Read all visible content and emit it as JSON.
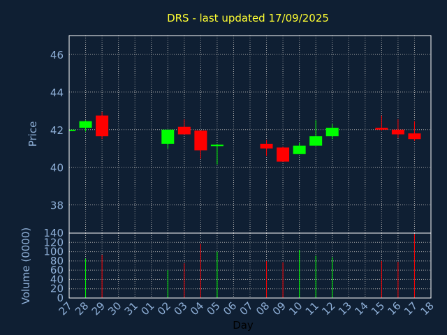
{
  "chart_data": {
    "type": "candlestick",
    "title": "DRS - last updated 17/09/2025",
    "xlabel": "Day",
    "price_ylabel": "Price",
    "volume_ylabel": "Volume (0000)",
    "price_ylim": [
      36.5,
      47
    ],
    "price_yticks": [
      38,
      40,
      42,
      44,
      46
    ],
    "volume_ylim": [
      0,
      140
    ],
    "volume_yticks": [
      0,
      20,
      40,
      60,
      80,
      100,
      120,
      140
    ],
    "grid": true,
    "x_labels": [
      "27",
      "28",
      "29",
      "30",
      "31",
      "01",
      "02",
      "03",
      "04",
      "05",
      "06",
      "07",
      "08",
      "09",
      "10",
      "11",
      "12",
      "13",
      "14",
      "15",
      "16",
      "17",
      "18"
    ],
    "candles": [
      {
        "day": "27",
        "open": 42.0,
        "high": 42.05,
        "low": 41.95,
        "close": 42.0,
        "volume": 0
      },
      {
        "day": "28",
        "open": 42.1,
        "high": 42.5,
        "low": 41.9,
        "close": 42.45,
        "volume": 85
      },
      {
        "day": "29",
        "open": 42.75,
        "high": 42.95,
        "low": 41.5,
        "close": 41.65,
        "volume": 93
      },
      {
        "day": "02",
        "open": 41.25,
        "high": 42.0,
        "low": 41.0,
        "close": 42.0,
        "volume": 60
      },
      {
        "day": "03",
        "open": 42.15,
        "high": 42.55,
        "low": 41.75,
        "close": 41.75,
        "volume": 75
      },
      {
        "day": "04",
        "open": 41.95,
        "high": 41.95,
        "low": 40.45,
        "close": 40.9,
        "volume": 117
      },
      {
        "day": "05",
        "open": 41.15,
        "high": 41.25,
        "low": 40.15,
        "close": 41.2,
        "volume": 100
      },
      {
        "day": "08",
        "open": 41.25,
        "high": 41.45,
        "low": 40.6,
        "close": 41.0,
        "volume": 80
      },
      {
        "day": "09",
        "open": 41.05,
        "high": 41.1,
        "low": 40.3,
        "close": 40.3,
        "volume": 77
      },
      {
        "day": "10",
        "open": 40.7,
        "high": 41.3,
        "low": 40.7,
        "close": 41.15,
        "volume": 104
      },
      {
        "day": "11",
        "open": 41.15,
        "high": 42.5,
        "low": 41.15,
        "close": 41.65,
        "volume": 91
      },
      {
        "day": "12",
        "open": 41.65,
        "high": 42.3,
        "low": 41.5,
        "close": 42.1,
        "volume": 88
      },
      {
        "day": "15",
        "open": 42.1,
        "high": 42.75,
        "low": 41.95,
        "close": 42.0,
        "volume": 80
      },
      {
        "day": "16",
        "open": 42.0,
        "high": 42.55,
        "low": 41.55,
        "close": 41.75,
        "volume": 78
      },
      {
        "day": "17",
        "open": 41.8,
        "high": 42.45,
        "low": 41.4,
        "close": 41.5,
        "volume": 138
      }
    ]
  },
  "colors": {
    "background": "#0f1f33",
    "axis_text": "#8fb0d8",
    "title": "#ffff33",
    "up": "#00ff00",
    "down": "#ff0000",
    "frame": "#ffffff",
    "grid": "#aaaaaa",
    "xlabel": "#000000"
  }
}
